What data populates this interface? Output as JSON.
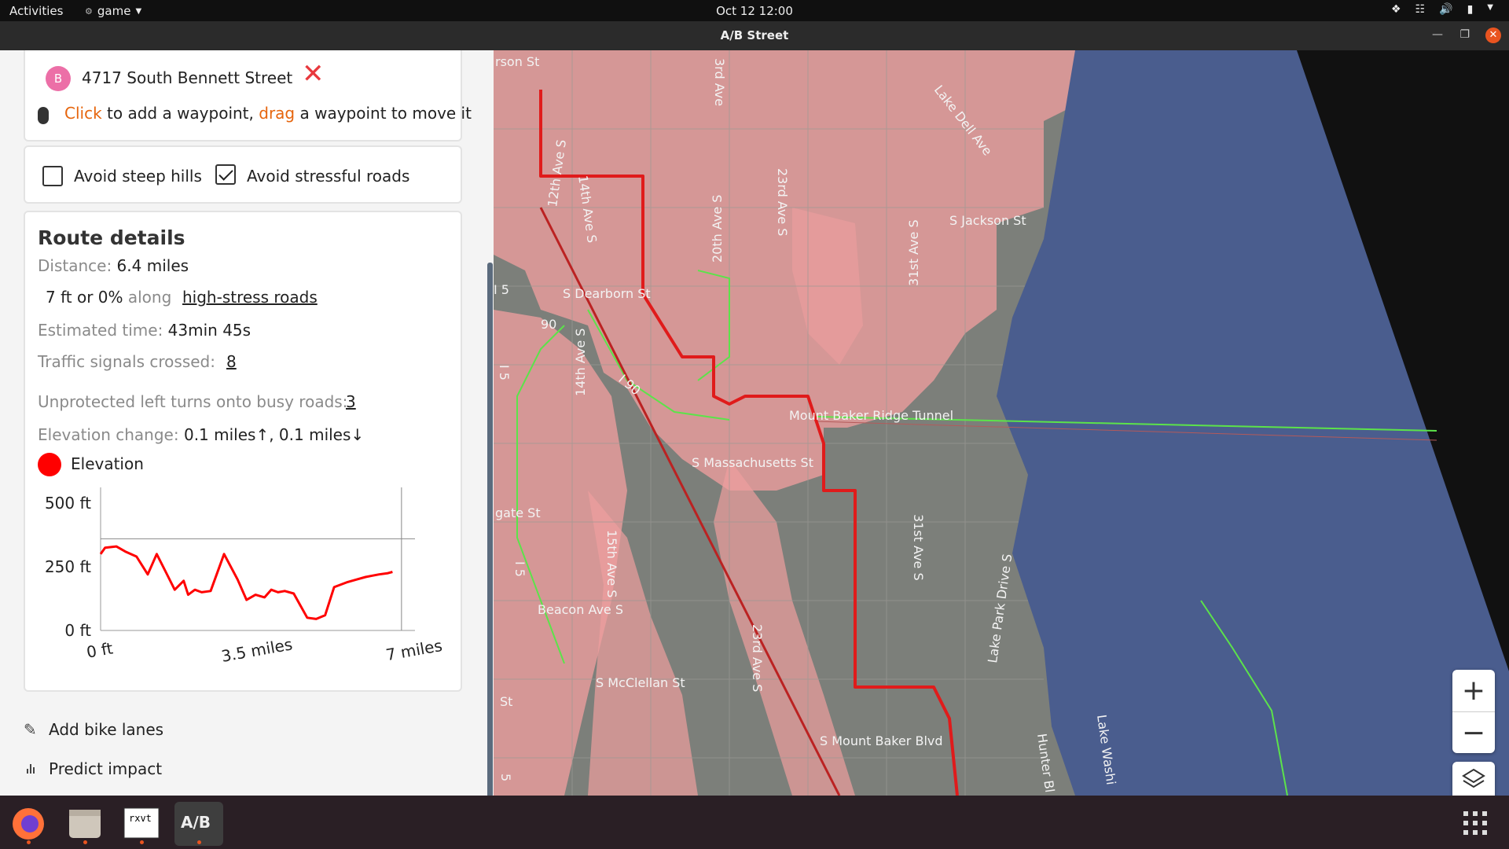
{
  "topbar": {
    "activities": "Activities",
    "app_menu": "game",
    "clock": "Oct 12  12:00"
  },
  "window": {
    "title": "A/B Street"
  },
  "route": {
    "destination_marker": "B",
    "destination": "4717 South Bennett Street",
    "hint_click": "Click",
    "hint_mid": " to add a waypoint, ",
    "hint_drag": "drag",
    "hint_end": " a waypoint to move it"
  },
  "options": {
    "avoid_hills_label": "Avoid steep hills",
    "avoid_hills_checked": false,
    "avoid_stress_label": "Avoid stressful roads",
    "avoid_stress_checked": true
  },
  "details": {
    "title": "Route details",
    "distance_label": "Distance:",
    "distance_value": " 6.4 miles",
    "stress_value": "7 ft or 0%",
    "stress_along": " along",
    "stress_link": "high-stress roads",
    "time_label": "Estimated time:",
    "time_value": " 43min 45s",
    "signals_label": "Traffic signals crossed:",
    "signals_value": "8",
    "left_turns_label": "Unprotected left turns onto busy roads:",
    "left_turns_value": "3",
    "elevation_label": "Elevation change:",
    "elevation_value": " 0.1 miles↑, 0.1 miles↓",
    "legend_label": "Elevation",
    "legend_color": "#ff0000"
  },
  "chart_data": {
    "type": "line",
    "title": "",
    "xlabel": "",
    "ylabel": "",
    "xlim": [
      0,
      7
    ],
    "ylim": [
      0,
      500
    ],
    "x_ticks": [
      "0 ft",
      "3.5 miles",
      "7 miles"
    ],
    "y_ticks": [
      "500 ft",
      "250 ft",
      "0 ft"
    ],
    "series": [
      {
        "name": "Elevation",
        "color": "#ff0000",
        "x": [
          0,
          0.1,
          0.35,
          0.55,
          0.8,
          1.05,
          1.25,
          1.45,
          1.65,
          1.85,
          1.95,
          2.1,
          2.25,
          2.45,
          2.75,
          3.05,
          3.25,
          3.45,
          3.65,
          3.8,
          3.95,
          4.1,
          4.3,
          4.6,
          4.8,
          5.0,
          5.2,
          5.5,
          5.7,
          5.9,
          6.05,
          6.2,
          6.4,
          6.5
        ],
        "y": [
          300,
          325,
          330,
          310,
          290,
          220,
          300,
          230,
          160,
          195,
          140,
          160,
          150,
          155,
          300,
          200,
          120,
          140,
          130,
          160,
          150,
          155,
          145,
          50,
          45,
          60,
          170,
          190,
          200,
          210,
          215,
          220,
          225,
          230
        ]
      }
    ],
    "cursor_x": 6.7,
    "reference_y": 360
  },
  "actions": {
    "add_bike_lanes": "Add bike lanes",
    "predict_impact": "Predict impact"
  },
  "map": {
    "streets": [
      {
        "text": "rson St"
      },
      {
        "text": "3rd Ave"
      },
      {
        "text": "Lake Dell Ave"
      },
      {
        "text": "12th Ave S"
      },
      {
        "text": "14th Ave S"
      },
      {
        "text": "20th Ave S"
      },
      {
        "text": "23rd Ave S"
      },
      {
        "text": "S Jackson St"
      },
      {
        "text": "S Dearborn St"
      },
      {
        "text": "90"
      },
      {
        "text": "I 90"
      },
      {
        "text": "31st Ave S"
      },
      {
        "text": "Mount Baker Ridge Tunnel"
      },
      {
        "text": "14th Ave S"
      },
      {
        "text": "S Massachusetts St"
      },
      {
        "text": "15th Ave S"
      },
      {
        "text": "31st Ave S"
      },
      {
        "text": "gate St"
      },
      {
        "text": "I 5"
      },
      {
        "text": "Lake Park Drive S"
      },
      {
        "text": "Beacon Ave S"
      },
      {
        "text": "S McClellan St"
      },
      {
        "text": "23rd Ave S"
      },
      {
        "text": "St"
      },
      {
        "text": "S Mount Baker Blvd"
      },
      {
        "text": "Lake Washi"
      },
      {
        "text": "Hunter Bl"
      },
      {
        "text": "I 5"
      },
      {
        "text": "5"
      },
      {
        "text": "I 5"
      }
    ],
    "zoom_in": "+",
    "zoom_out": "−",
    "colors": {
      "water": "#4a5d8e",
      "high_stress": "#ee9e9e",
      "route": "#e01b1b",
      "bike_lane": "#5ce34a"
    }
  },
  "dock": {
    "terminal_text": "rxvt",
    "abst_text": "A/B"
  }
}
